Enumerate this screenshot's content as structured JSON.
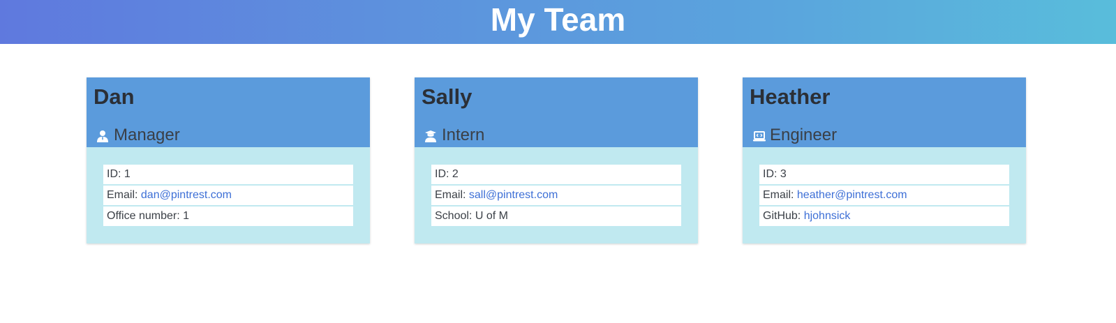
{
  "header": {
    "title": "My Team"
  },
  "team": [
    {
      "name": "Dan",
      "role": "Manager",
      "icon": "manager-icon",
      "id_label": "ID: 1",
      "email_prefix": "Email: ",
      "email": "dan@pintrest.com",
      "extra_prefix": "Office number: 1",
      "extra_link": ""
    },
    {
      "name": "Sally",
      "role": "Intern",
      "icon": "graduate-icon",
      "id_label": "ID: 2",
      "email_prefix": "Email: ",
      "email": "sall@pintrest.com",
      "extra_prefix": "School: U of M",
      "extra_link": ""
    },
    {
      "name": "Heather",
      "role": "Engineer",
      "icon": "laptop-code-icon",
      "id_label": "ID: 3",
      "email_prefix": "Email: ",
      "email": "heather@pintrest.com",
      "extra_prefix": "GitHub: ",
      "extra_link": "hjohnsick"
    }
  ],
  "colors": {
    "header_gradient_start": "#5f79de",
    "header_gradient_end": "#59bddb",
    "card_head": "#5b9bdc",
    "card_body": "#c0e9f0",
    "link": "#3d6fd6"
  }
}
